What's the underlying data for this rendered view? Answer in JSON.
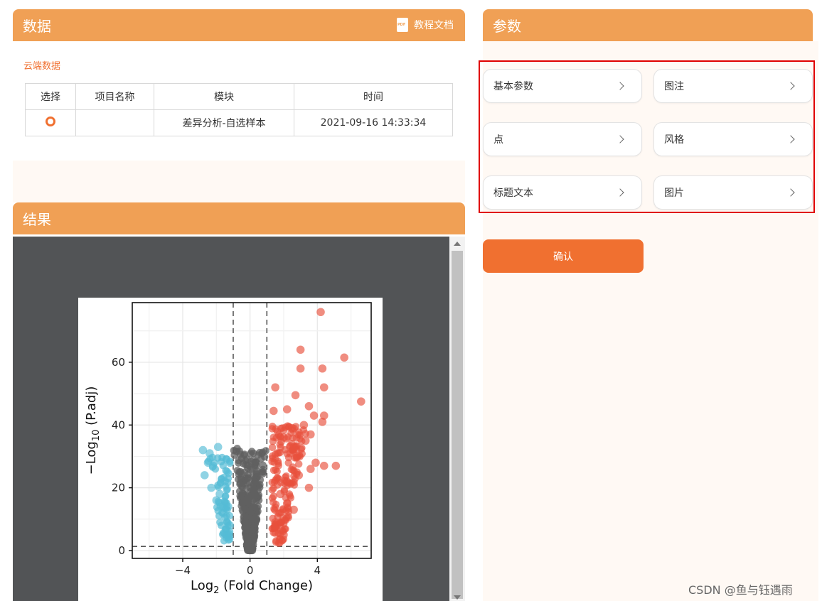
{
  "data_panel": {
    "title": "数据",
    "tutorial_label": "教程文档",
    "pdf_icon_text": "PDF",
    "cloud_label": "云端数据",
    "table": {
      "headers": [
        "选择",
        "项目名称",
        "模块",
        "时间"
      ],
      "rows": [
        {
          "project": "",
          "module": "差异分析-自选样本",
          "time": "2021-09-16 14:33:34"
        }
      ]
    }
  },
  "params_panel": {
    "title": "参数",
    "buttons": [
      "基本参数",
      "图注",
      "点",
      "风格",
      "标题文本",
      "图片"
    ],
    "confirm_label": "确认"
  },
  "result_panel": {
    "title": "结果"
  },
  "watermark": "CSDN @鱼与钰遇雨",
  "colors": {
    "header": "#f0a055",
    "accent": "#f07030",
    "up": "#e8503c",
    "down": "#55bcd6",
    "ns": "#606060"
  },
  "chart_data": {
    "type": "scatter",
    "x_ticks": [
      "-4",
      "0",
      "4"
    ],
    "y_ticks": [
      "0",
      "20",
      "40",
      "60"
    ],
    "xlabel_base": "Log",
    "xlabel_sub": "2",
    "xlabel_rest": " (Fold Change)",
    "ylabel_base": "−Log",
    "ylabel_sub": "10",
    "ylabel_rest": " (P.adj)",
    "xlim": [
      -7,
      7.2
    ],
    "ylim": [
      -2.5,
      79
    ],
    "fc_threshold": [
      -1,
      1
    ],
    "p_threshold": 1.3,
    "series": [
      {
        "group": "up",
        "points": [
          [
            4.2,
            76
          ],
          [
            3,
            64
          ],
          [
            5.6,
            61.5
          ],
          [
            3,
            58
          ],
          [
            4.3,
            58
          ],
          [
            6.6,
            47.5
          ],
          [
            1.5,
            52
          ],
          [
            4.4,
            52
          ],
          [
            2.7,
            49.5
          ],
          [
            1.4,
            44.5
          ],
          [
            2.2,
            45
          ],
          [
            3.5,
            46
          ],
          [
            3.8,
            43
          ],
          [
            4.4,
            43
          ],
          [
            4.3,
            41
          ],
          [
            3.2,
            40
          ],
          [
            2.5,
            39
          ],
          [
            3.6,
            37
          ],
          [
            3.3,
            35
          ],
          [
            2.6,
            33
          ],
          [
            2.0,
            36
          ],
          [
            2.4,
            31
          ],
          [
            2.8,
            30
          ],
          [
            3.9,
            28
          ],
          [
            4.4,
            27
          ],
          [
            5.1,
            27
          ],
          [
            3.6,
            26
          ],
          [
            2.9,
            24
          ],
          [
            2.2,
            22
          ],
          [
            3.5,
            20
          ],
          [
            1.8,
            18
          ],
          [
            2.2,
            15
          ],
          [
            2.6,
            13
          ],
          [
            1.5,
            9
          ],
          [
            2.0,
            5
          ]
        ]
      },
      {
        "group": "down",
        "points": [
          [
            -2.8,
            32
          ],
          [
            -1.9,
            33
          ],
          [
            -2.4,
            31
          ],
          [
            -2.5,
            28
          ],
          [
            -1.4,
            29
          ],
          [
            -2.2,
            27
          ],
          [
            -2.7,
            24
          ],
          [
            -1.5,
            22
          ],
          [
            -2.3,
            20
          ],
          [
            -1.8,
            18
          ],
          [
            -2.0,
            16
          ],
          [
            -1.3,
            14
          ],
          [
            -1.6,
            12
          ],
          [
            -1.2,
            8
          ],
          [
            -1.4,
            5
          ]
        ]
      }
    ]
  }
}
